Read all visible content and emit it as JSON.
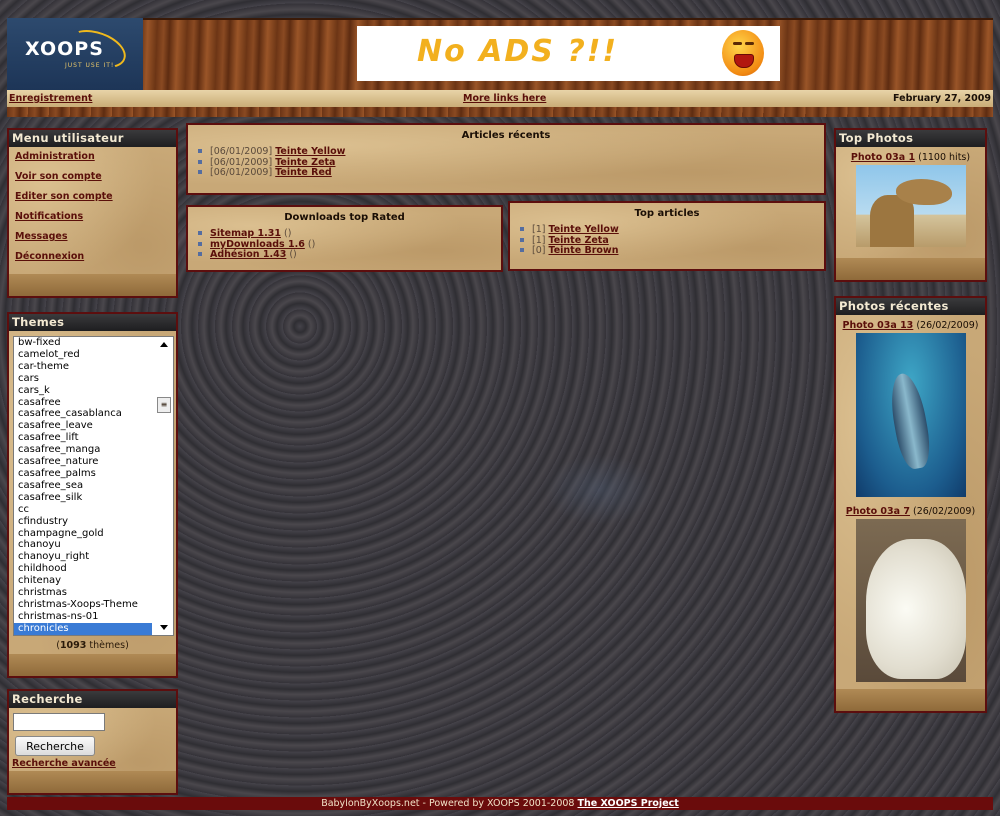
{
  "header": {
    "logo_text": "XOOPS",
    "logo_tagline": "JUST USE IT!",
    "ad_text": "No ADS ?!!",
    "register_link": "Enregistrement",
    "more_links": "More links here",
    "date": "February 27, 2009"
  },
  "user_menu": {
    "title": "Menu utilisateur",
    "items": [
      "Administration",
      "Voir son compte",
      "Editer son compte",
      "Notifications",
      "Messages",
      "Déconnexion"
    ]
  },
  "themes": {
    "title": "Themes",
    "options": [
      "bw-fixed",
      "camelot_red",
      "car-theme",
      "cars",
      "cars_k",
      "casafree",
      "casafree_casablanca",
      "casafree_leave",
      "casafree_lift",
      "casafree_manga",
      "casafree_nature",
      "casafree_palms",
      "casafree_sea",
      "casafree_silk",
      "cc",
      "cfindustry",
      "champagne_gold",
      "chanoyu",
      "chanoyu_right",
      "childhood",
      "chitenay",
      "christmas",
      "christmas-Xoops-Theme",
      "christmas-ns-01",
      "chronicles"
    ],
    "selected": "chronicles",
    "count_number": "1093",
    "count_label": "thèmes"
  },
  "search": {
    "title": "Recherche",
    "input_value": "",
    "button_label": "Recherche",
    "advanced_link": "Recherche avancée"
  },
  "recent_articles": {
    "title": "Articles récents",
    "items": [
      {
        "date": "[06/01/2009]",
        "link": "Teinte Yellow"
      },
      {
        "date": "[06/01/2009]",
        "link": "Teinte Zeta"
      },
      {
        "date": "[06/01/2009]",
        "link": "Teinte Red"
      }
    ]
  },
  "top_downloads": {
    "title": "Downloads top Rated",
    "items": [
      {
        "link": "Sitemap 1.31",
        "suffix": "()"
      },
      {
        "link": "myDownloads 1.6",
        "suffix": "()"
      },
      {
        "link": "Adhésion 1.43",
        "suffix": "()"
      }
    ]
  },
  "top_articles": {
    "title": "Top articles",
    "items": [
      {
        "count": "[1]",
        "link": "Teinte Yellow"
      },
      {
        "count": "[1]",
        "link": "Teinte Zeta"
      },
      {
        "count": "[0]",
        "link": "Teinte Brown"
      }
    ]
  },
  "top_photos": {
    "title": "Top Photos",
    "photo_link": "Photo 03a 1",
    "photo_extra": "(1100 hits)"
  },
  "recent_photos": {
    "title": "Photos récentes",
    "photos": [
      {
        "link": "Photo 03a 13",
        "date": "(26/02/2009)"
      },
      {
        "link": "Photo 03a 7",
        "date": "(26/02/2009)"
      }
    ]
  },
  "footer": {
    "text": "BabylonByXoops.net - Powered by XOOPS 2001-2008",
    "link": "The XOOPS Project"
  }
}
